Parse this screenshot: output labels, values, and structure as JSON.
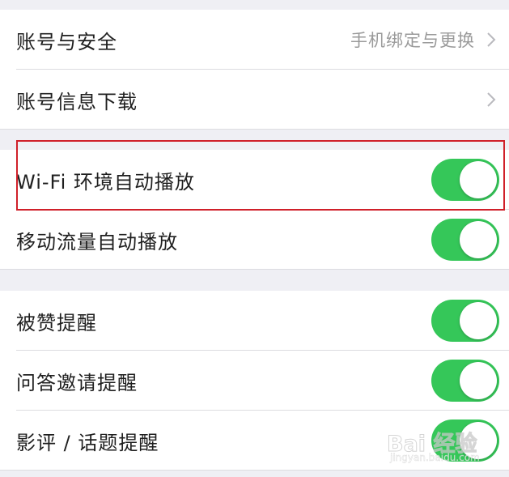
{
  "account_section": {
    "items": [
      {
        "label": "账号与安全",
        "value": "手机绑定与更换"
      },
      {
        "label": "账号信息下载",
        "value": ""
      }
    ]
  },
  "autoplay_section": {
    "items": [
      {
        "label": "Wi-Fi 环境自动播放",
        "on": true
      },
      {
        "label": "移动流量自动播放",
        "on": true
      }
    ]
  },
  "notify_section": {
    "items": [
      {
        "label": "被赞提醒",
        "on": true
      },
      {
        "label": "问答邀请提醒",
        "on": true
      },
      {
        "label": "影评 / 话题提醒",
        "on": true
      }
    ]
  },
  "watermark": {
    "text": "Bai 经验",
    "sub": "jingyan.baidu.com"
  },
  "colors": {
    "toggle_on": "#35c759",
    "highlight": "#d0202a",
    "background": "#efeff4"
  }
}
